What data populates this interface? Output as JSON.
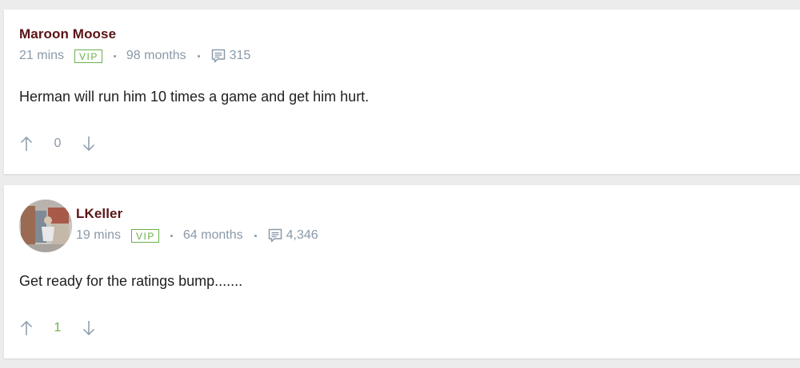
{
  "comments": [
    {
      "author": "Maroon Moose",
      "time": "21 mins",
      "vip_label": "VIP",
      "member_for": "98 months",
      "comment_count": "315",
      "text": "Herman will run him 10 times a game and get him hurt.",
      "score": "0",
      "score_color": "#8a99a8",
      "has_avatar": false
    },
    {
      "author": "LKeller",
      "time": "19 mins",
      "vip_label": "VIP",
      "member_for": "64 months",
      "comment_count": "4,346",
      "text": "Get ready for the ratings bump.......",
      "score": "1",
      "score_color": "#6ab04c",
      "has_avatar": true
    }
  ],
  "icons": {
    "comments": "comment-bubble-icon",
    "upvote": "arrow-up-icon",
    "downvote": "arrow-down-icon"
  },
  "colors": {
    "author": "#5a1416",
    "meta": "#8a99a8",
    "vip": "#6ab04c",
    "positive_score": "#6ab04c"
  }
}
